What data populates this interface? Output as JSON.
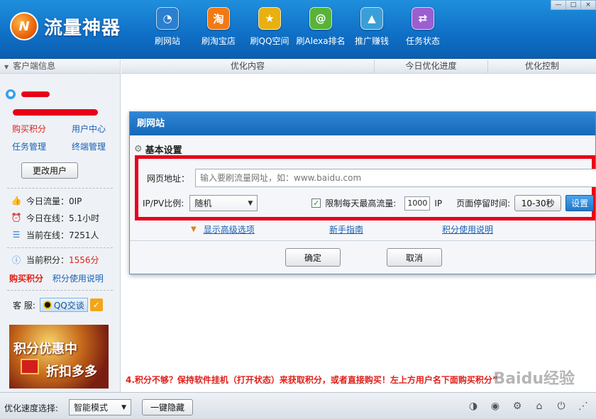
{
  "app": {
    "title": "流量神器",
    "logo_letters": "N"
  },
  "nav": [
    {
      "label": "刷网站",
      "icon": "globe-icon",
      "glyph": "◔",
      "color": "#2a7fd0"
    },
    {
      "label": "刷淘宝店",
      "icon": "taobao-icon",
      "glyph": "淘",
      "color": "#f07a16"
    },
    {
      "label": "刷QQ空间",
      "icon": "star-icon",
      "glyph": "★",
      "color": "#e8b010"
    },
    {
      "label": "刷Alexa排名",
      "icon": "at-icon",
      "glyph": "@",
      "color": "#59b33a"
    },
    {
      "label": "推广赚钱",
      "icon": "rocket-icon",
      "glyph": "▲",
      "color": "#3a9fd8"
    },
    {
      "label": "任务状态",
      "icon": "swap-arrows-icon",
      "glyph": "⇄",
      "color": "#9a5fd0"
    }
  ],
  "window_controls": {
    "minimize": "—",
    "restore": "□",
    "close": "×"
  },
  "sidebar": {
    "header": "客户端信息",
    "links": [
      "购买积分",
      "用户中心",
      "任务管理",
      "终端管理"
    ],
    "change_user": "更改用户",
    "stats": [
      {
        "label": "今日流量：0IP"
      },
      {
        "label": "今日在线：5.1小时"
      },
      {
        "label": "当前在线：7251人"
      }
    ],
    "points_label": "当前积分：",
    "points_value": "1556分",
    "buy_points": "购买积分",
    "points_help": "积分使用说明",
    "service_label": "客 服:",
    "qq_chat": "QQ交谈",
    "promo_line1": "积分优惠中",
    "promo_line2": "折扣多多"
  },
  "main": {
    "columns": [
      "优化内容",
      "今日优化进度",
      "优化控制"
    ],
    "notice": "4.积分不够？保持软件挂机（打开状态）来获取积分，或者直接购买！左上方用户名下面购买积分”",
    "watermark": "Baidu经验"
  },
  "dialog": {
    "title": "刷网站",
    "section": "基本设置",
    "url_label": "网页地址：",
    "url_placeholder": "输入要刷流量网址，如：www.baidu.com",
    "ratio_label": "IP/PV比例:",
    "ratio_value": "随机",
    "limit_label": "限制每天最高流量:",
    "limit_value": "1000",
    "limit_unit": "IP",
    "stay_label": "页面停留时间:",
    "stay_value": "10-30秒",
    "set_button": "设置",
    "advanced": "显示高级选项",
    "guide": "新手指南",
    "points_help": "积分使用说明",
    "ok": "确定",
    "cancel": "取消"
  },
  "bottom": {
    "speed_label": "优化速度选择:",
    "speed_value": "智能模式",
    "hide_button": "一键隐藏"
  }
}
